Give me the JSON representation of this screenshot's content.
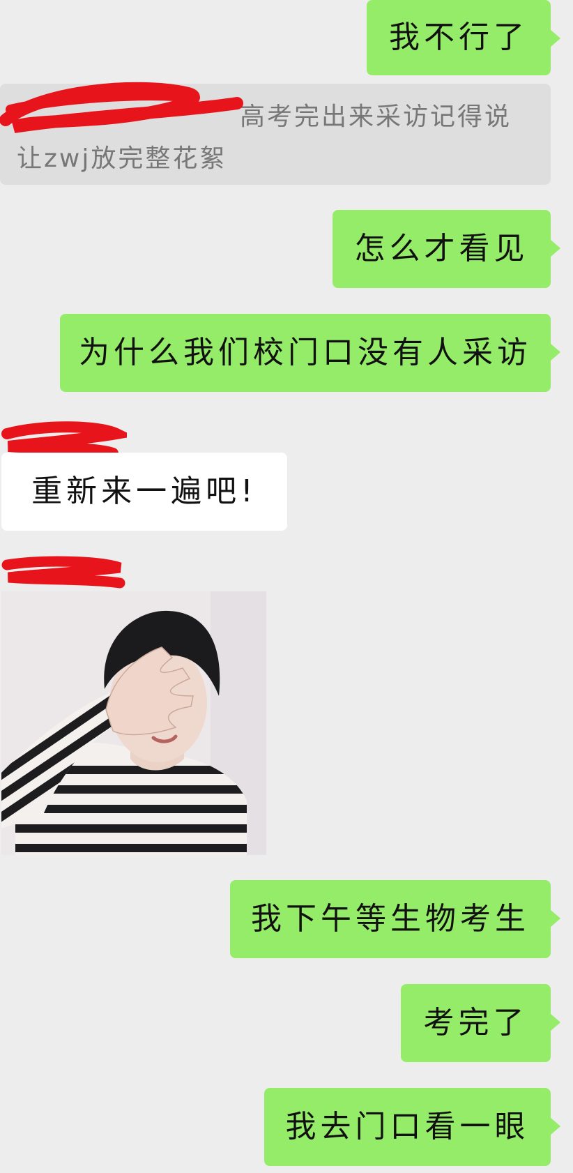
{
  "messages": [
    {
      "side": "sent",
      "type": "text",
      "text": "我不行了"
    },
    {
      "side": "quote",
      "type": "quote",
      "text_line1": "高考完出来采访记得说",
      "text_line2": "让zwj放完整花絮"
    },
    {
      "side": "sent",
      "type": "text",
      "text": "怎么才看见"
    },
    {
      "side": "sent",
      "type": "text",
      "text": "为什么我们校门口没有人采访"
    },
    {
      "side": "received",
      "type": "text",
      "text": "重新来一遍吧!"
    },
    {
      "side": "received",
      "type": "sticker",
      "icon": "person-covering-face-sticker"
    },
    {
      "side": "sent",
      "type": "text",
      "text": "我下午等生物考生"
    },
    {
      "side": "sent",
      "type": "text",
      "text": "考完了"
    },
    {
      "side": "sent",
      "type": "text",
      "text": "我去门口看一眼"
    }
  ],
  "colors": {
    "background": "#ededed",
    "sent_bubble": "#95ec69",
    "received_bubble": "#ffffff",
    "quote_bubble": "#dedede",
    "redaction": "#e8141b"
  }
}
